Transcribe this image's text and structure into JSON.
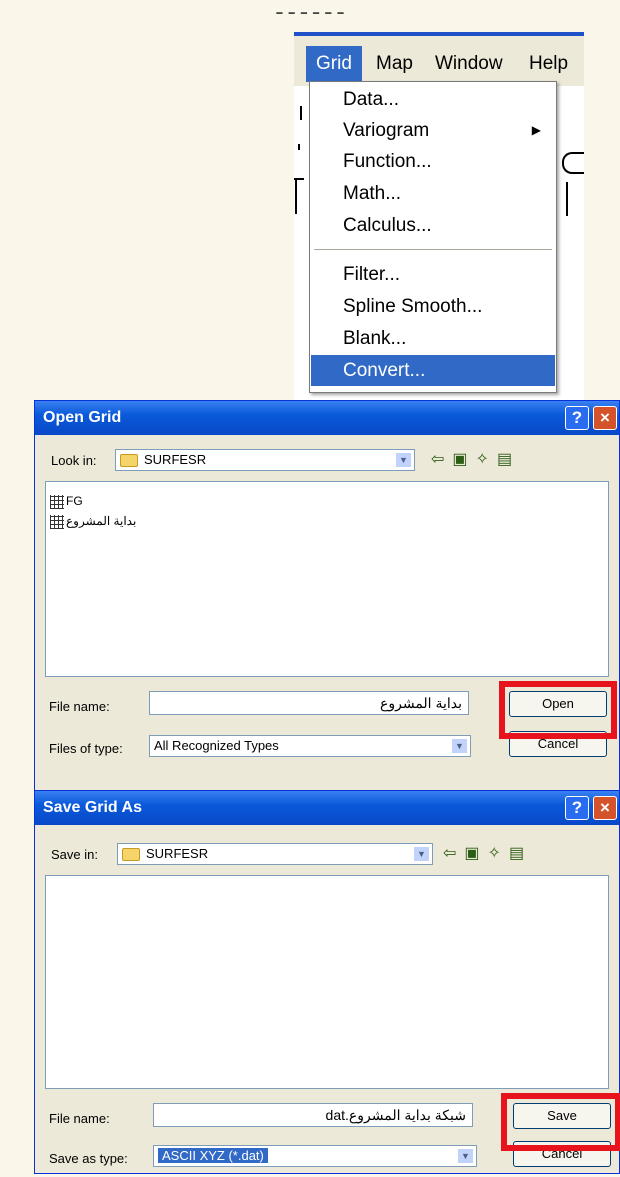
{
  "top_caption": "ـ ـ ـ ـ ـ ـ",
  "menubar": {
    "items": [
      "Grid",
      "Map",
      "Window",
      "Help"
    ],
    "active": "Grid"
  },
  "grid_menu": {
    "items": [
      "Data...",
      "Variogram",
      "Function...",
      "Math...",
      "Calculus...",
      "Filter...",
      "Spline Smooth...",
      "Blank...",
      "Convert..."
    ],
    "highlighted": "Convert...",
    "submenu_item": "Variogram"
  },
  "open_dialog": {
    "title": "Open Grid",
    "help_btn": "?",
    "close_btn": "×",
    "look_in_label": "Look in:",
    "look_in_value": "SURFESR",
    "files": [
      "FG",
      "بداية المشروع"
    ],
    "selected_file": "بداية المشروع",
    "file_name_label": "File name:",
    "file_name_value": "بداية المشروع",
    "files_of_type_label": "Files of type:",
    "files_of_type_value": "All Recognized Types",
    "open_button": "Open",
    "cancel_button": "Cancel"
  },
  "save_dialog": {
    "title": "Save Grid As",
    "help_btn": "?",
    "close_btn": "×",
    "save_in_label": "Save in:",
    "save_in_value": "SURFESR",
    "file_name_label": "File name:",
    "file_name_value": "شبكة بداية المشروع.dat",
    "save_as_type_label": "Save as type:",
    "save_as_type_value": "ASCII XYZ (*.dat)",
    "save_button": "Save",
    "cancel_button": "Cancel"
  },
  "colors": {
    "highlight": "#3169c6",
    "titlebar": "#0a5ad9",
    "annotation_red": "#e8141d",
    "background": "#faf7ea"
  }
}
